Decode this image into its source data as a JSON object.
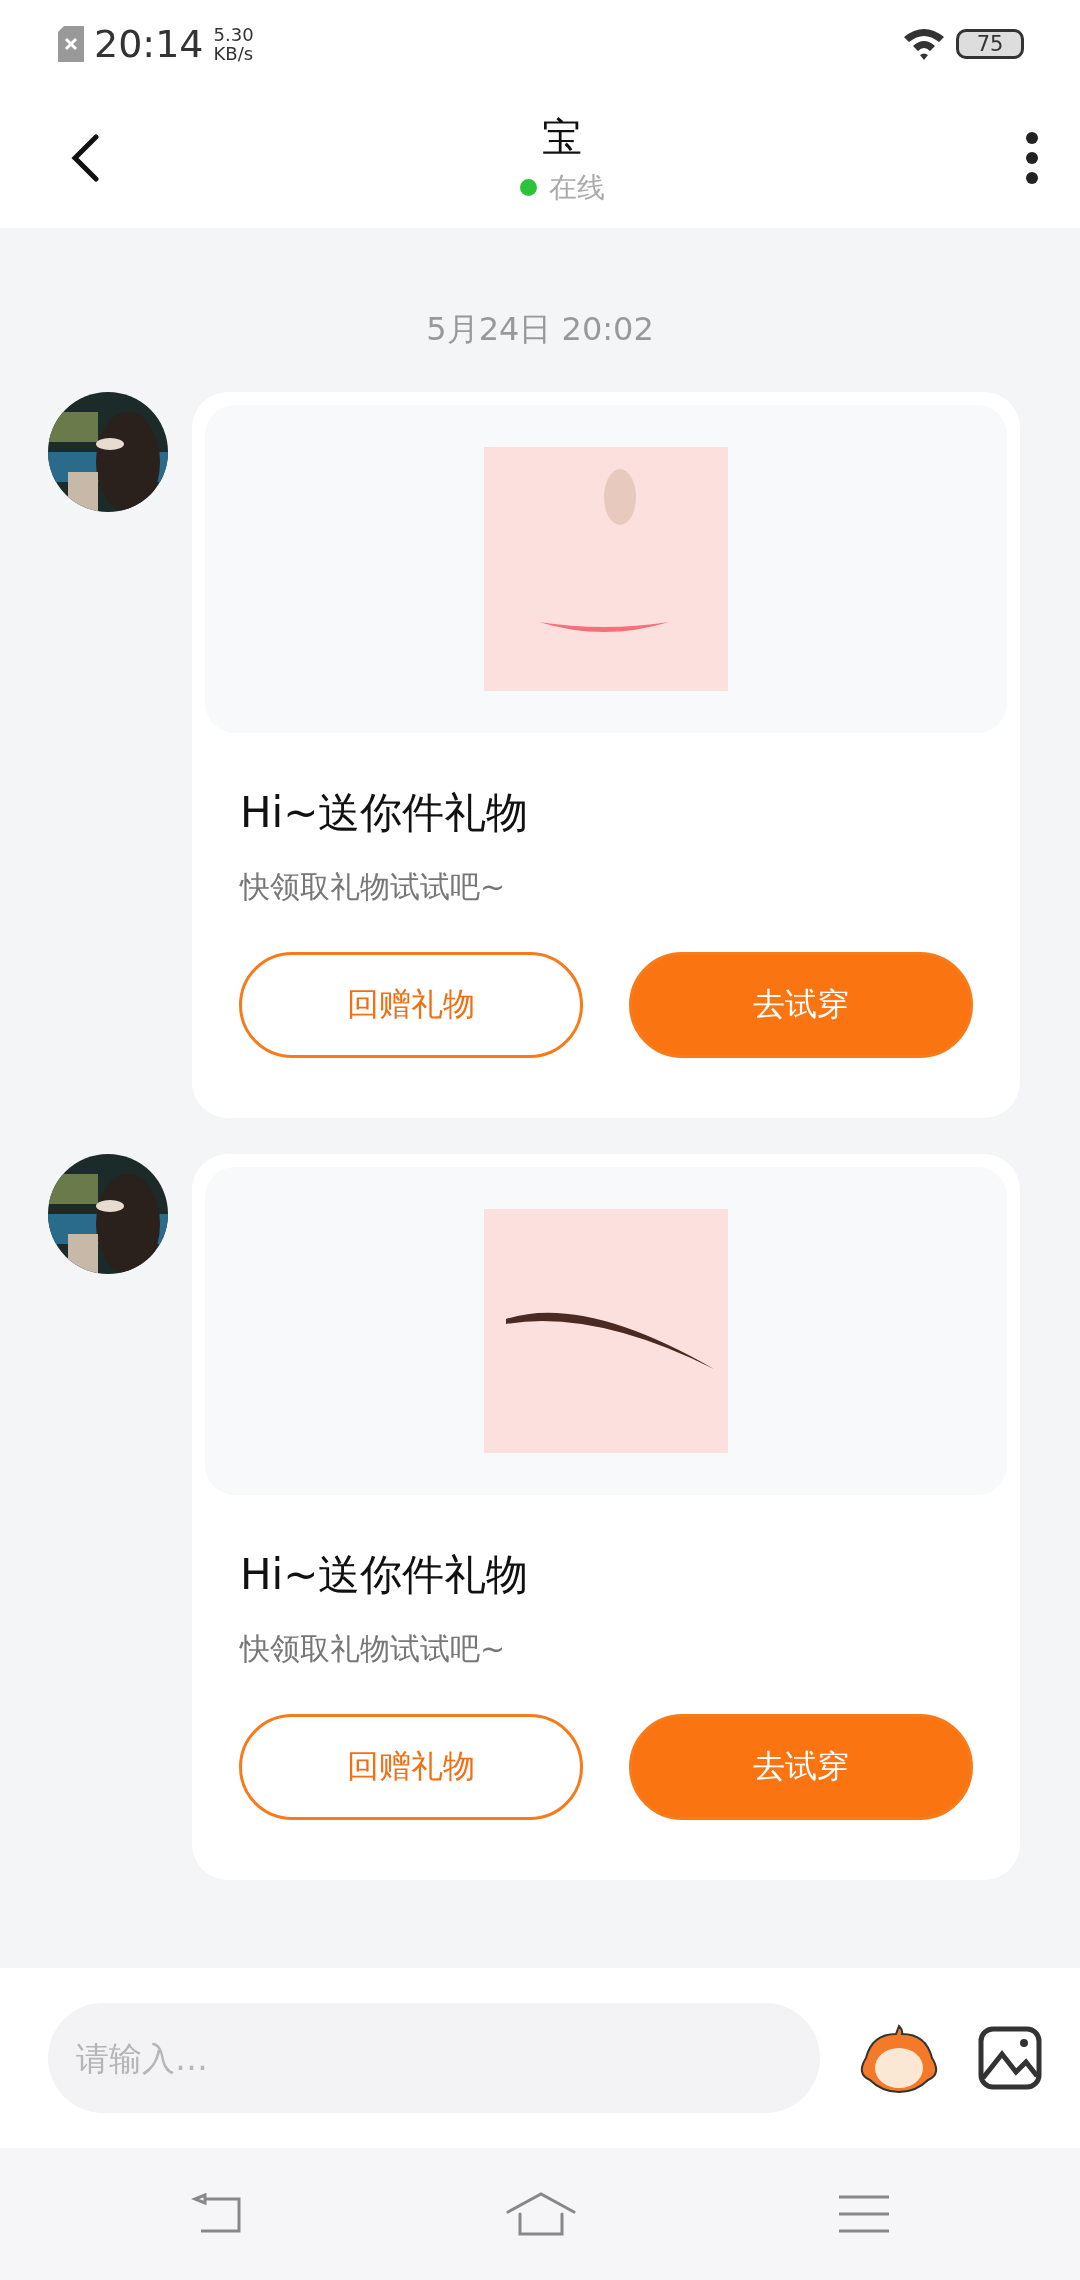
{
  "status_bar": {
    "time": "20:14",
    "speed": "5.30",
    "speed_unit": "KB/s",
    "battery": "75"
  },
  "header": {
    "title": "宝",
    "status": "在线",
    "online": true
  },
  "date": "5月24日 20:02",
  "messages": [
    {
      "title": "Hi~送你件礼物",
      "subtitle": "快领取礼物试试吧~",
      "buttons": [
        {
          "label": "回赠礼物",
          "kind": "outline"
        },
        {
          "label": "去试穿",
          "kind": "filled"
        }
      ]
    },
    {
      "title": "Hi~送你件礼物",
      "subtitle": "快领取礼物试试吧~",
      "buttons": [
        {
          "label": "回赠礼物",
          "kind": "outline"
        },
        {
          "label": "去试穿",
          "kind": "filled"
        }
      ]
    }
  ],
  "input": {
    "placeholder": "请输入…"
  }
}
